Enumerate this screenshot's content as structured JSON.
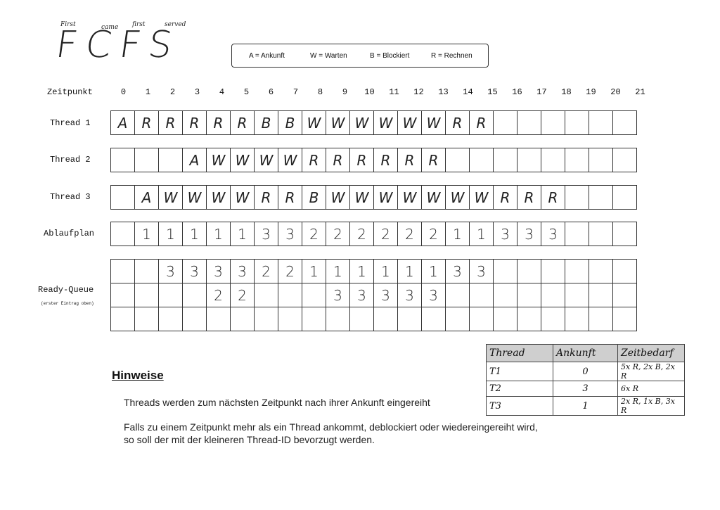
{
  "logo": {
    "main": "FCFS",
    "words": [
      "First",
      "came",
      "first",
      "served"
    ]
  },
  "legend": {
    "items": [
      "A = Ankunft",
      "W = Warten",
      "B = Blockiert",
      "R = Rechnen"
    ]
  },
  "timeline": {
    "label": "Zeitpunkt",
    "ticks": [
      "0",
      "1",
      "2",
      "3",
      "4",
      "5",
      "6",
      "7",
      "8",
      "9",
      "10",
      "11",
      "12",
      "13",
      "14",
      "15",
      "16",
      "17",
      "18",
      "19",
      "20",
      "21"
    ]
  },
  "rows": [
    {
      "label": "Thread 1",
      "cells": [
        "A",
        "R",
        "R",
        "R",
        "R",
        "R",
        "B",
        "B",
        "W",
        "W",
        "W",
        "W",
        "W",
        "W",
        "R",
        "R",
        "",
        "",
        "",
        "",
        "",
        ""
      ]
    },
    {
      "label": "Thread 2",
      "cells": [
        "",
        "",
        "",
        "A",
        "W",
        "W",
        "W",
        "W",
        "R",
        "R",
        "R",
        "R",
        "R",
        "R",
        "",
        "",
        "",
        "",
        "",
        "",
        "",
        ""
      ]
    },
    {
      "label": "Thread 3",
      "cells": [
        "",
        "A",
        "W",
        "W",
        "W",
        "W",
        "R",
        "R",
        "B",
        "W",
        "W",
        "W",
        "W",
        "W",
        "W",
        "W",
        "R",
        "R",
        "R",
        "",
        "",
        ""
      ]
    },
    {
      "label": "Ablaufplan",
      "cells": [
        "",
        "1",
        "1",
        "1",
        "1",
        "1",
        "3",
        "3",
        "2",
        "2",
        "2",
        "2",
        "2",
        "2",
        "1",
        "1",
        "3",
        "3",
        "3",
        "",
        "",
        ""
      ]
    }
  ],
  "ready_queue": {
    "label": "Ready-Queue",
    "note": "(erster Eintrag oben)",
    "rows": [
      [
        "",
        "",
        "3",
        "3",
        "3",
        "3",
        "2",
        "2",
        "1",
        "1",
        "1",
        "1",
        "1",
        "1",
        "3",
        "3",
        "",
        "",
        "",
        "",
        "",
        ""
      ],
      [
        "",
        "",
        "",
        "",
        "2",
        "2",
        "",
        "",
        "",
        "3",
        "3",
        "3",
        "3",
        "3",
        "",
        "",
        "",
        "",
        "",
        "",
        "",
        ""
      ],
      [
        "",
        "",
        "",
        "",
        "",
        "",
        "",
        "",
        "",
        "",
        "",
        "",
        "",
        "",
        "",
        "",
        "",
        "",
        "",
        "",
        "",
        ""
      ]
    ]
  },
  "hints": {
    "title": "Hinweise",
    "line1": "Threads werden zum nächsten Zeitpunkt nach ihrer Ankunft eingereiht",
    "line2": "Falls zu einem Zeitpunkt  mehr als ein Thread ankommt, deblockiert oder wiedereingereiht wird,",
    "line3": "so soll der mit der kleineren Thread-ID bevorzugt werden."
  },
  "thread_table": {
    "headers": [
      "Thread",
      "Ankunft",
      "Zeitbedarf"
    ],
    "rows": [
      [
        "T1",
        "0",
        "5x R, 2x B, 2x R"
      ],
      [
        "T2",
        "3",
        "6x R"
      ],
      [
        "T3",
        "1",
        "2x R, 1x B, 3x R"
      ]
    ]
  }
}
